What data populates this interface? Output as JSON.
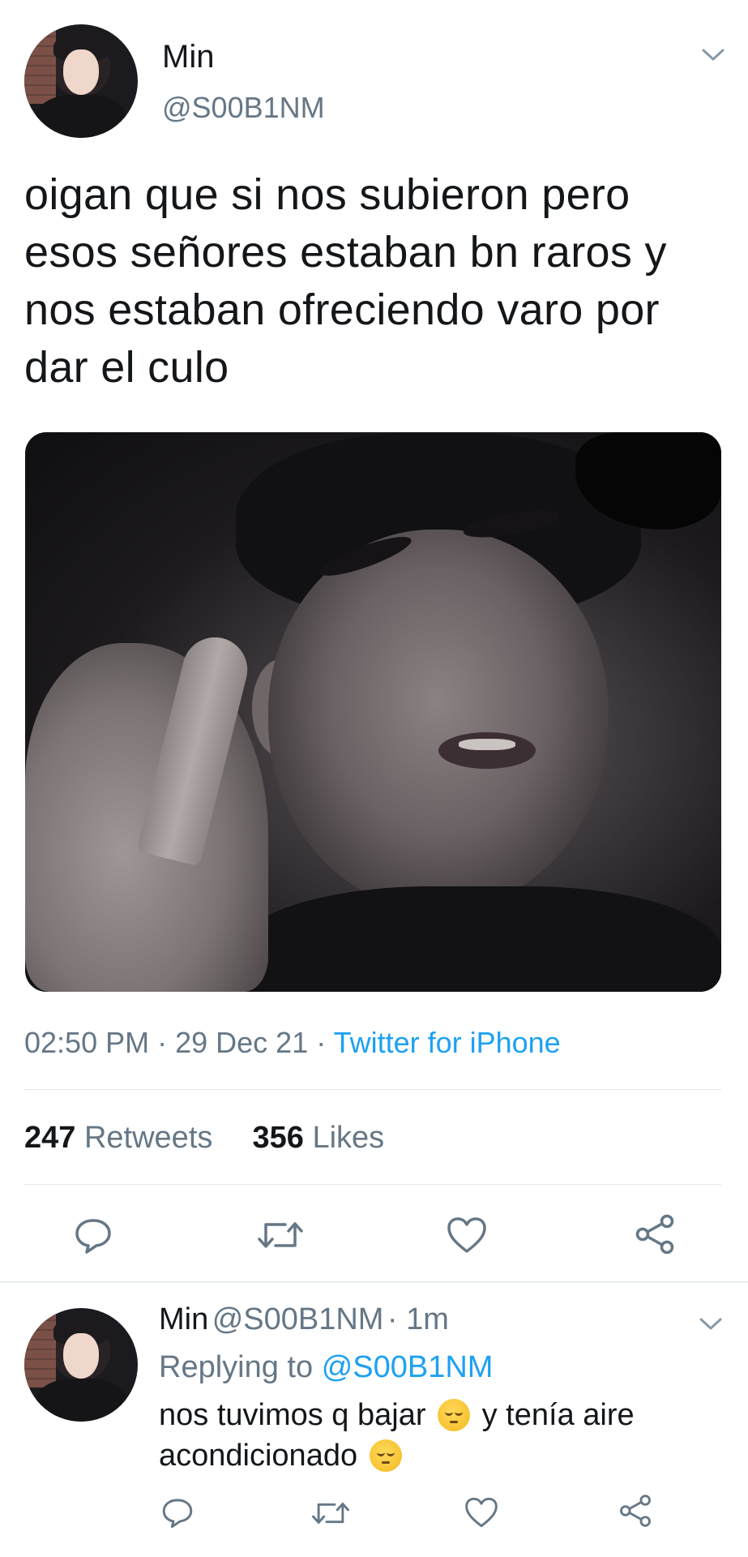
{
  "tweet": {
    "author_name": "Min",
    "author_handle": "@S00B1NM",
    "text": "oigan que si nos subieron pero esos señores estaban bn raros y nos estaban ofreciendo varo por dar el culo",
    "time": "02:50 PM",
    "date": "29 Dec 21",
    "source": "Twitter for iPhone",
    "retweets_count": "247",
    "retweets_label": "Retweets",
    "likes_count": "356",
    "likes_label": "Likes"
  },
  "reply": {
    "author_name": "Min",
    "author_handle": "@S00B1NM",
    "age": "1m",
    "replying_label": "Replying to",
    "replying_to": "@S00B1NM",
    "text_part1": "nos tuvimos q bajar",
    "text_part2": "y tenía aire",
    "text_part3": "acondicionado"
  },
  "icons": {
    "reply": "reply-icon",
    "retweet": "retweet-icon",
    "like": "heart-icon",
    "share": "share-icon",
    "menu": "chevron-down-icon",
    "emoji": "pensive-face-emoji"
  },
  "colors": {
    "link": "#1da1f2",
    "secondary_text": "#657786",
    "primary_text": "#14171a",
    "divider": "#e1e8ed"
  }
}
